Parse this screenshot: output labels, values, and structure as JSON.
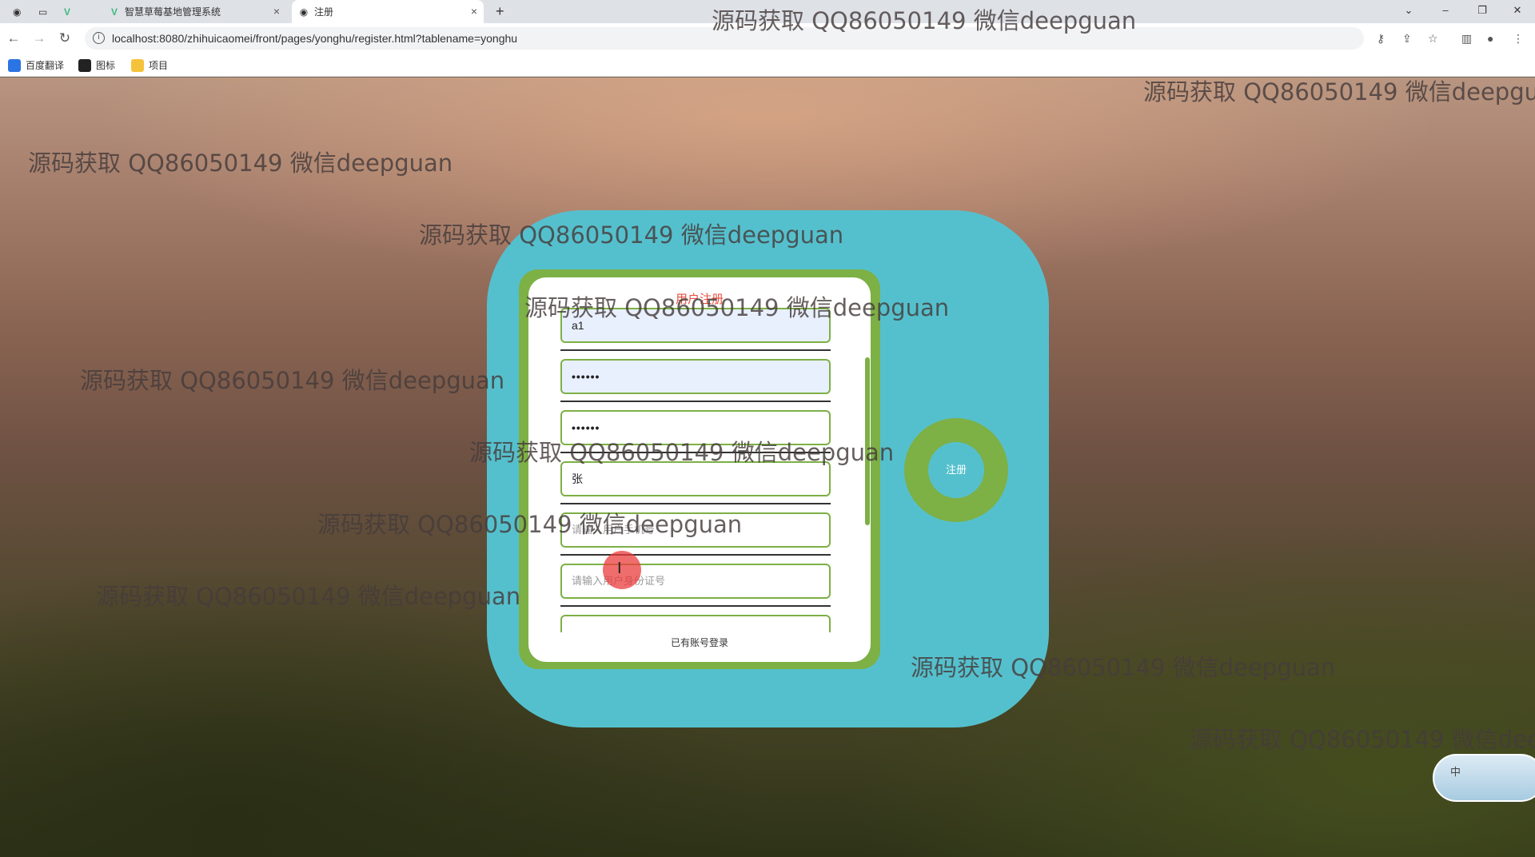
{
  "browser": {
    "tabs": [
      {
        "title": ""
      },
      {
        "title": ""
      },
      {
        "title": ""
      },
      {
        "title": "智慧草莓基地管理系统"
      },
      {
        "title": "注册"
      }
    ],
    "url": "localhost:8080/zhihuicaomei/front/pages/yonghu/register.html?tablename=yonghu",
    "bookmarks": [
      {
        "label": "百度翻译"
      },
      {
        "label": "图标"
      },
      {
        "label": "项目"
      }
    ]
  },
  "form": {
    "title": "用户注册",
    "fields": [
      {
        "value": "a1",
        "placeholder": ""
      },
      {
        "value": "••••••",
        "placeholder": ""
      },
      {
        "value": "••••••",
        "placeholder": ""
      },
      {
        "value": "张",
        "placeholder": ""
      },
      {
        "value": "",
        "placeholder": "请输入用户手机号"
      },
      {
        "value": "",
        "placeholder": "请输入用户身份证号"
      }
    ],
    "login_link": "已有账号登录",
    "register_button": "注册"
  },
  "watermark": "源码获取 QQ86050149 微信deepguan",
  "ime": {
    "label": "中"
  },
  "colors": {
    "teal": "#55c0cd",
    "green": "#7db045",
    "title_red": "#e74c3c"
  }
}
